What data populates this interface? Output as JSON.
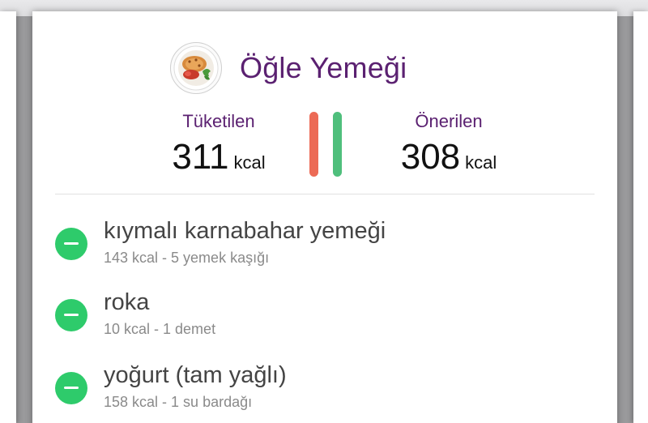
{
  "meal": {
    "title": "Öğle Yemeği",
    "icon": "salad-plate-icon"
  },
  "summary": {
    "consumed_label": "Tüketilen",
    "consumed_value": "311",
    "consumed_unit": "kcal",
    "suggested_label": "Önerilen",
    "suggested_value": "308",
    "suggested_unit": "kcal",
    "consumed_color": "#ec6a55",
    "suggested_color": "#4fbf7c"
  },
  "foods": [
    {
      "name": "kıymalı karnabahar yemeği",
      "detail": "143 kcal - 5 yemek kaşığı"
    },
    {
      "name": "roka",
      "detail": "10 kcal - 1 demet"
    },
    {
      "name": "yoğurt (tam yağlı)",
      "detail": "158 kcal - 1 su bardağı"
    }
  ],
  "colors": {
    "accent": "#5b2171",
    "remove_button": "#2ecb6b"
  }
}
